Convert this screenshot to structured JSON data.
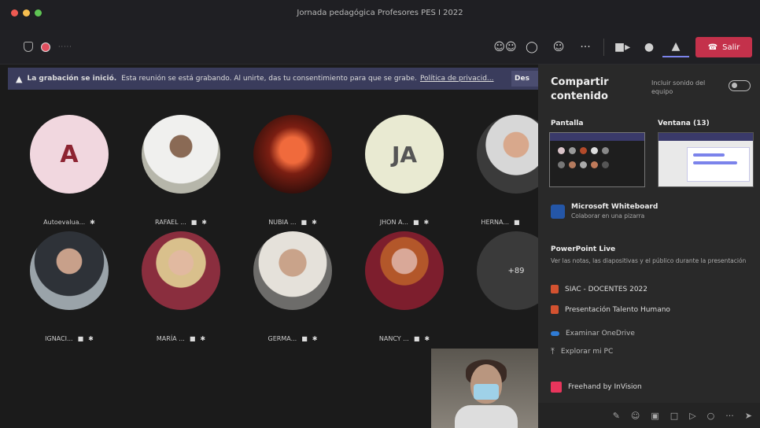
{
  "window": {
    "title": "Jornada pedagógica Profesores PES I 2022",
    "traffic_lights": [
      "#ee5a52",
      "#f5bd4f",
      "#5fc454"
    ]
  },
  "toolbar": {
    "timer": "·····",
    "leave_label": "Salir",
    "leave_color": "#c4314b",
    "icons": [
      "people-icon",
      "chat-icon",
      "reactions-icon",
      "more-icon",
      "camera-icon",
      "mic-icon",
      "share-icon"
    ]
  },
  "banner": {
    "bold": "La grabación se inició.",
    "text": "Esta reunión se está grabando. Al unirte, das tu consentimiento para que se grabe.",
    "link": "Política de privacid...",
    "dismiss": "Des"
  },
  "participants": [
    {
      "name": "Autoevalua...",
      "initials": "A"
    },
    {
      "name": "RAFAEL ...",
      "initials": ""
    },
    {
      "name": "NUBIA ...",
      "initials": ""
    },
    {
      "name": "JHON A...",
      "initials": "JA"
    },
    {
      "name": "HERNA...",
      "initials": ""
    },
    {
      "name": "IGNACI...",
      "initials": ""
    },
    {
      "name": "MARÍA ...",
      "initials": ""
    },
    {
      "name": "GERMA...",
      "initials": ""
    },
    {
      "name": "NANCY ...",
      "initials": ""
    }
  ],
  "overflow_count": "+89",
  "share_panel": {
    "title": "Compartir contenido",
    "system_sound": "Incluir sonido del equipo",
    "screen_label": "Pantalla",
    "window_label": "Ventana (13)",
    "whiteboard_title": "Microsoft Whiteboard",
    "whiteboard_sub": "Colaborar en una pizarra",
    "powerpoint_title": "PowerPoint Live",
    "powerpoint_desc": "Ver las notas, las diapositivas y el público durante la presentación",
    "files": [
      "SIAC - DOCENTES 2022",
      "Presentación Talento Humano"
    ],
    "browse_onedrive": "Examinar OneDrive",
    "browse_pc": "Explorar mi PC",
    "freehand": "Freehand by InVision"
  }
}
